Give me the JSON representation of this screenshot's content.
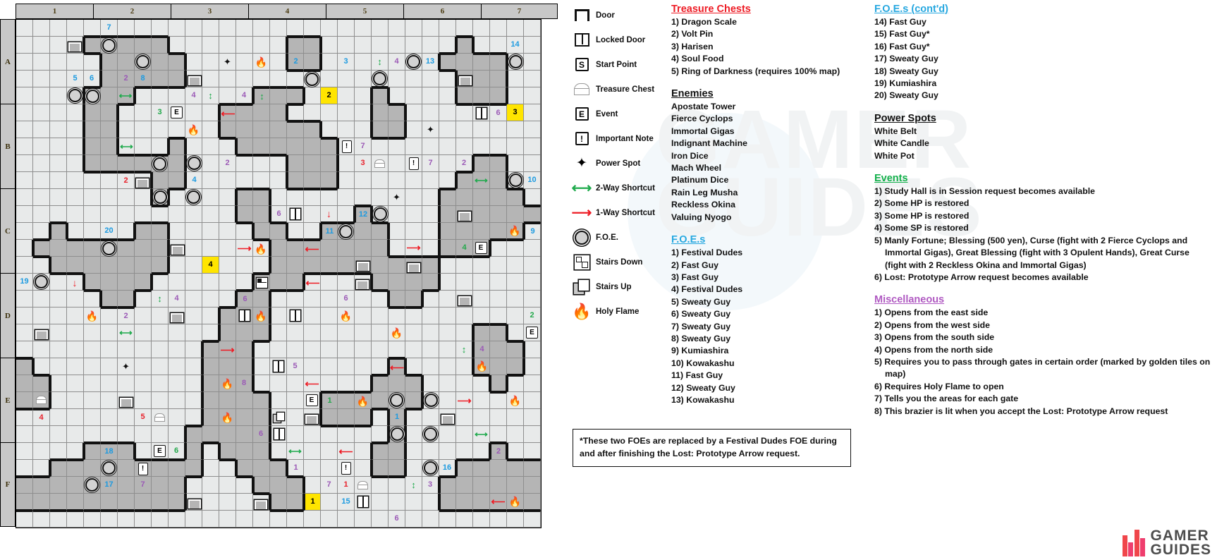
{
  "map": {
    "col_headers": [
      "1",
      "2",
      "3",
      "4",
      "5",
      "6",
      "7"
    ],
    "row_headers": [
      "A",
      "B",
      "C",
      "D",
      "E",
      "F"
    ],
    "cols": 31,
    "rows": 30,
    "markers": [
      {
        "c": 5,
        "r": 0,
        "type": "num",
        "text": "7",
        "color": "blue"
      },
      {
        "c": 5,
        "r": 1,
        "type": "foe"
      },
      {
        "c": 3,
        "r": 1,
        "type": "door"
      },
      {
        "c": 7,
        "r": 2,
        "type": "foe"
      },
      {
        "c": 12,
        "r": 2,
        "type": "spark"
      },
      {
        "c": 14,
        "r": 2,
        "type": "flame"
      },
      {
        "c": 16,
        "r": 2,
        "type": "num",
        "text": "2",
        "color": "blue"
      },
      {
        "c": 19,
        "r": 2,
        "type": "num",
        "text": "3",
        "color": "blue"
      },
      {
        "c": 21,
        "r": 2,
        "type": "shortcut2v"
      },
      {
        "c": 22,
        "r": 2,
        "type": "num",
        "text": "4",
        "color": "purple"
      },
      {
        "c": 23,
        "r": 2,
        "type": "foe"
      },
      {
        "c": 24,
        "r": 2,
        "type": "num",
        "text": "13",
        "color": "blue"
      },
      {
        "c": 29,
        "r": 1,
        "type": "num",
        "text": "14",
        "color": "blue"
      },
      {
        "c": 29,
        "r": 2,
        "type": "foe"
      },
      {
        "c": 3,
        "r": 3,
        "type": "num",
        "text": "5",
        "color": "blue"
      },
      {
        "c": 4,
        "r": 3,
        "type": "num",
        "text": "6",
        "color": "blue"
      },
      {
        "c": 6,
        "r": 3,
        "type": "num",
        "text": "2",
        "color": "purple"
      },
      {
        "c": 7,
        "r": 3,
        "type": "num",
        "text": "8",
        "color": "blue"
      },
      {
        "c": 10,
        "r": 3,
        "type": "door"
      },
      {
        "c": 17,
        "r": 3,
        "type": "foe"
      },
      {
        "c": 21,
        "r": 3,
        "type": "foe"
      },
      {
        "c": 26,
        "r": 3,
        "type": "door"
      },
      {
        "c": 3,
        "r": 4,
        "type": "foe"
      },
      {
        "c": 4,
        "r": 4,
        "type": "foe"
      },
      {
        "c": 6,
        "r": 4,
        "type": "shortcut2h"
      },
      {
        "c": 10,
        "r": 4,
        "type": "num",
        "text": "4",
        "color": "purple"
      },
      {
        "c": 11,
        "r": 4,
        "type": "shortcut2v"
      },
      {
        "c": 13,
        "r": 4,
        "type": "num",
        "text": "4",
        "color": "purple"
      },
      {
        "c": 14,
        "r": 4,
        "type": "shortcut2v"
      },
      {
        "c": 18,
        "r": 4,
        "type": "gold",
        "text": "2"
      },
      {
        "c": 8,
        "r": 5,
        "type": "num",
        "text": "3",
        "color": "green"
      },
      {
        "c": 9,
        "r": 5,
        "type": "event"
      },
      {
        "c": 12,
        "r": 5,
        "type": "shortcut1l"
      },
      {
        "c": 27,
        "r": 5,
        "type": "lockdoor"
      },
      {
        "c": 28,
        "r": 5,
        "type": "num",
        "text": "6",
        "color": "purple"
      },
      {
        "c": 29,
        "r": 5,
        "type": "gold",
        "text": "3"
      },
      {
        "c": 10,
        "r": 6,
        "type": "flame"
      },
      {
        "c": 24,
        "r": 6,
        "type": "spark"
      },
      {
        "c": 6,
        "r": 7,
        "type": "shortcut2h"
      },
      {
        "c": 19,
        "r": 7,
        "type": "note"
      },
      {
        "c": 20,
        "r": 7,
        "type": "num",
        "text": "7",
        "color": "purple"
      },
      {
        "c": 8,
        "r": 8,
        "type": "foe"
      },
      {
        "c": 10,
        "r": 8,
        "type": "foe"
      },
      {
        "c": 12,
        "r": 8,
        "type": "num",
        "text": "2",
        "color": "purple"
      },
      {
        "c": 20,
        "r": 8,
        "type": "num",
        "text": "3",
        "color": "red"
      },
      {
        "c": 21,
        "r": 8,
        "type": "chest"
      },
      {
        "c": 23,
        "r": 8,
        "type": "note"
      },
      {
        "c": 24,
        "r": 8,
        "type": "num",
        "text": "7",
        "color": "purple"
      },
      {
        "c": 26,
        "r": 8,
        "type": "num",
        "text": "2",
        "color": "purple"
      },
      {
        "c": 6,
        "r": 9,
        "type": "num",
        "text": "2",
        "color": "red"
      },
      {
        "c": 7,
        "r": 9,
        "type": "door"
      },
      {
        "c": 10,
        "r": 9,
        "type": "num",
        "text": "4",
        "color": "blue"
      },
      {
        "c": 27,
        "r": 9,
        "type": "shortcut2h"
      },
      {
        "c": 29,
        "r": 9,
        "type": "foe"
      },
      {
        "c": 30,
        "r": 9,
        "type": "num",
        "text": "10",
        "color": "blue"
      },
      {
        "c": 8,
        "r": 10,
        "type": "foe"
      },
      {
        "c": 10,
        "r": 10,
        "type": "foe"
      },
      {
        "c": 22,
        "r": 10,
        "type": "spark"
      },
      {
        "c": 15,
        "r": 11,
        "type": "num",
        "text": "6",
        "color": "purple"
      },
      {
        "c": 16,
        "r": 11,
        "type": "lockdoor"
      },
      {
        "c": 18,
        "r": 11,
        "type": "shortcut1d"
      },
      {
        "c": 20,
        "r": 11,
        "type": "num",
        "text": "12",
        "color": "blue"
      },
      {
        "c": 21,
        "r": 11,
        "type": "foe"
      },
      {
        "c": 26,
        "r": 11,
        "type": "door"
      },
      {
        "c": 5,
        "r": 12,
        "type": "num",
        "text": "20",
        "color": "blue"
      },
      {
        "c": 18,
        "r": 12,
        "type": "num",
        "text": "11",
        "color": "blue"
      },
      {
        "c": 19,
        "r": 12,
        "type": "foe"
      },
      {
        "c": 29,
        "r": 12,
        "type": "flame"
      },
      {
        "c": 30,
        "r": 12,
        "type": "num",
        "text": "9",
        "color": "blue"
      },
      {
        "c": 5,
        "r": 13,
        "type": "foe"
      },
      {
        "c": 9,
        "r": 13,
        "type": "door"
      },
      {
        "c": 13,
        "r": 13,
        "type": "shortcut1r"
      },
      {
        "c": 14,
        "r": 13,
        "type": "flame"
      },
      {
        "c": 17,
        "r": 13,
        "type": "shortcut1l"
      },
      {
        "c": 23,
        "r": 13,
        "type": "shortcut1r"
      },
      {
        "c": 26,
        "r": 13,
        "type": "num",
        "text": "4",
        "color": "green"
      },
      {
        "c": 27,
        "r": 13,
        "type": "event"
      },
      {
        "c": 11,
        "r": 14,
        "type": "gold",
        "text": "4"
      },
      {
        "c": 20,
        "r": 14,
        "type": "door"
      },
      {
        "c": 23,
        "r": 14,
        "type": "door"
      },
      {
        "c": 0,
        "r": 15,
        "type": "num",
        "text": "19",
        "color": "blue"
      },
      {
        "c": 1,
        "r": 15,
        "type": "foe"
      },
      {
        "c": 3,
        "r": 15,
        "type": "shortcut1d"
      },
      {
        "c": 14,
        "r": 15,
        "type": "stairsdown"
      },
      {
        "c": 17,
        "r": 15,
        "type": "shortcut1l"
      },
      {
        "c": 20,
        "r": 15,
        "type": "door"
      },
      {
        "c": 8,
        "r": 16,
        "type": "shortcut2v"
      },
      {
        "c": 9,
        "r": 16,
        "type": "num",
        "text": "4",
        "color": "purple"
      },
      {
        "c": 13,
        "r": 16,
        "type": "num",
        "text": "6",
        "color": "purple"
      },
      {
        "c": 19,
        "r": 16,
        "type": "num",
        "text": "6",
        "color": "purple"
      },
      {
        "c": 26,
        "r": 16,
        "type": "door"
      },
      {
        "c": 4,
        "r": 17,
        "type": "flame"
      },
      {
        "c": 6,
        "r": 17,
        "type": "num",
        "text": "2",
        "color": "purple"
      },
      {
        "c": 9,
        "r": 17,
        "type": "door"
      },
      {
        "c": 13,
        "r": 17,
        "type": "lockdoor"
      },
      {
        "c": 14,
        "r": 17,
        "type": "flame"
      },
      {
        "c": 16,
        "r": 17,
        "type": "lockdoor"
      },
      {
        "c": 19,
        "r": 17,
        "type": "flame"
      },
      {
        "c": 30,
        "r": 17,
        "type": "num",
        "text": "2",
        "color": "green"
      },
      {
        "c": 1,
        "r": 18,
        "type": "door"
      },
      {
        "c": 6,
        "r": 18,
        "type": "shortcut2h"
      },
      {
        "c": 22,
        "r": 18,
        "type": "flame"
      },
      {
        "c": 30,
        "r": 18,
        "type": "event"
      },
      {
        "c": 12,
        "r": 19,
        "type": "shortcut1r"
      },
      {
        "c": 26,
        "r": 19,
        "type": "shortcut2v"
      },
      {
        "c": 27,
        "r": 19,
        "type": "num",
        "text": "4",
        "color": "purple"
      },
      {
        "c": 6,
        "r": 20,
        "type": "spark"
      },
      {
        "c": 15,
        "r": 20,
        "type": "lockdoor"
      },
      {
        "c": 16,
        "r": 20,
        "type": "num",
        "text": "5",
        "color": "purple"
      },
      {
        "c": 22,
        "r": 20,
        "type": "shortcut1l"
      },
      {
        "c": 27,
        "r": 20,
        "type": "flame"
      },
      {
        "c": 12,
        "r": 21,
        "type": "flame"
      },
      {
        "c": 13,
        "r": 21,
        "type": "num",
        "text": "8",
        "color": "purple"
      },
      {
        "c": 17,
        "r": 21,
        "type": "shortcut1l"
      },
      {
        "c": 1,
        "r": 22,
        "type": "chest"
      },
      {
        "c": 6,
        "r": 22,
        "type": "door"
      },
      {
        "c": 17,
        "r": 22,
        "type": "event"
      },
      {
        "c": 18,
        "r": 22,
        "type": "num",
        "text": "1",
        "color": "green"
      },
      {
        "c": 20,
        "r": 22,
        "type": "flame"
      },
      {
        "c": 22,
        "r": 22,
        "type": "foe"
      },
      {
        "c": 24,
        "r": 22,
        "type": "foe"
      },
      {
        "c": 26,
        "r": 22,
        "type": "shortcut1r"
      },
      {
        "c": 29,
        "r": 22,
        "type": "flame"
      },
      {
        "c": 1,
        "r": 23,
        "type": "num",
        "text": "4",
        "color": "red"
      },
      {
        "c": 7,
        "r": 23,
        "type": "num",
        "text": "5",
        "color": "red"
      },
      {
        "c": 8,
        "r": 23,
        "type": "chest"
      },
      {
        "c": 12,
        "r": 23,
        "type": "flame"
      },
      {
        "c": 15,
        "r": 23,
        "type": "stairsup"
      },
      {
        "c": 17,
        "r": 23,
        "type": "door"
      },
      {
        "c": 22,
        "r": 23,
        "type": "num",
        "text": "1",
        "color": "blue"
      },
      {
        "c": 25,
        "r": 23,
        "type": "door"
      },
      {
        "c": 14,
        "r": 24,
        "type": "num",
        "text": "6",
        "color": "purple"
      },
      {
        "c": 15,
        "r": 24,
        "type": "lockdoor"
      },
      {
        "c": 22,
        "r": 24,
        "type": "foe"
      },
      {
        "c": 24,
        "r": 24,
        "type": "foe"
      },
      {
        "c": 27,
        "r": 24,
        "type": "shortcut2h"
      },
      {
        "c": 5,
        "r": 25,
        "type": "num",
        "text": "18",
        "color": "blue"
      },
      {
        "c": 8,
        "r": 25,
        "type": "event"
      },
      {
        "c": 9,
        "r": 25,
        "type": "num",
        "text": "6",
        "color": "green"
      },
      {
        "c": 16,
        "r": 25,
        "type": "shortcut2h"
      },
      {
        "c": 19,
        "r": 25,
        "type": "shortcut1l"
      },
      {
        "c": 28,
        "r": 25,
        "type": "num",
        "text": "2",
        "color": "purple"
      },
      {
        "c": 5,
        "r": 26,
        "type": "foe"
      },
      {
        "c": 7,
        "r": 26,
        "type": "note"
      },
      {
        "c": 16,
        "r": 26,
        "type": "num",
        "text": "1",
        "color": "purple"
      },
      {
        "c": 19,
        "r": 26,
        "type": "note"
      },
      {
        "c": 24,
        "r": 26,
        "type": "foe"
      },
      {
        "c": 25,
        "r": 26,
        "type": "num",
        "text": "16",
        "color": "blue"
      },
      {
        "c": 4,
        "r": 27,
        "type": "foe"
      },
      {
        "c": 5,
        "r": 27,
        "type": "num",
        "text": "17",
        "color": "blue"
      },
      {
        "c": 7,
        "r": 27,
        "type": "num",
        "text": "7",
        "color": "purple"
      },
      {
        "c": 18,
        "r": 27,
        "type": "num",
        "text": "7",
        "color": "purple"
      },
      {
        "c": 19,
        "r": 27,
        "type": "num",
        "text": "1",
        "color": "red"
      },
      {
        "c": 20,
        "r": 27,
        "type": "chest"
      },
      {
        "c": 23,
        "r": 27,
        "type": "shortcut2v"
      },
      {
        "c": 24,
        "r": 27,
        "type": "num",
        "text": "3",
        "color": "purple"
      },
      {
        "c": 10,
        "r": 28,
        "type": "door"
      },
      {
        "c": 14,
        "r": 28,
        "type": "door"
      },
      {
        "c": 17,
        "r": 28,
        "type": "gold",
        "text": "1"
      },
      {
        "c": 20,
        "r": 28,
        "type": "lockdoor"
      },
      {
        "c": 19,
        "r": 28,
        "type": "num",
        "text": "15",
        "color": "blue"
      },
      {
        "c": 28,
        "r": 28,
        "type": "shortcut1l"
      },
      {
        "c": 29,
        "r": 28,
        "type": "flame"
      },
      {
        "c": 22,
        "r": 29,
        "type": "num",
        "text": "6",
        "color": "purple"
      }
    ]
  },
  "legend": {
    "items": [
      {
        "icon": "door-icon",
        "label": "Door"
      },
      {
        "icon": "locked-door-icon",
        "label": "Locked Door"
      },
      {
        "icon": "start-point-icon",
        "label": "Start Point"
      },
      {
        "icon": "treasure-chest-icon",
        "label": "Treasure Chest"
      },
      {
        "icon": "event-icon",
        "label": "Event"
      },
      {
        "icon": "important-note-icon",
        "label": "Important Note"
      },
      {
        "icon": "power-spot-icon",
        "label": "Power Spot"
      },
      {
        "icon": "two-way-shortcut-icon",
        "label": "2-Way Shortcut"
      },
      {
        "icon": "one-way-shortcut-icon",
        "label": "1-Way Shortcut"
      },
      {
        "icon": "foe-icon",
        "label": "F.O.E."
      },
      {
        "icon": "stairs-down-icon",
        "label": "Stairs Down"
      },
      {
        "icon": "stairs-up-icon",
        "label": "Stairs Up"
      },
      {
        "icon": "holy-flame-icon",
        "label": "Holy Flame"
      }
    ],
    "start_point_letter": "S",
    "event_letter": "E",
    "note_mark": "!"
  },
  "sections": {
    "treasure_chests": {
      "title": "Treasure Chests",
      "items": [
        "1) Dragon Scale",
        "2) Volt Pin",
        "3) Harisen",
        "4) Soul Food",
        "5) Ring of Darkness (requires 100% map)"
      ]
    },
    "enemies": {
      "title": "Enemies",
      "items": [
        "Apostate Tower",
        "Fierce Cyclops",
        "Immortal Gigas",
        "Indignant Machine",
        "Iron Dice",
        "Mach Wheel",
        "Platinum Dice",
        "Rain Leg Musha",
        "Reckless Okina",
        "Valuing Nyogo"
      ]
    },
    "foes": {
      "title": "F.O.E.s",
      "items": [
        "1) Festival Dudes",
        "2) Fast Guy",
        "3) Fast Guy",
        "4) Festival Dudes",
        "5) Sweaty Guy",
        "6) Sweaty Guy",
        "7) Sweaty Guy",
        "8) Sweaty Guy",
        "9) Kumiashira",
        "10) Kowakashu",
        "11) Fast Guy",
        "12) Sweaty Guy",
        "13) Kowakashu"
      ]
    },
    "foes_cont": {
      "title": "F.O.E.s (cont'd)",
      "items": [
        "14) Fast Guy",
        "15) Fast Guy*",
        "16) Fast Guy*",
        "17) Sweaty Guy",
        "18) Sweaty Guy",
        "19) Kumiashira",
        "20) Sweaty Guy"
      ]
    },
    "power_spots": {
      "title": "Power Spots",
      "items": [
        "White Belt",
        "White Candle",
        "White Pot"
      ]
    },
    "events": {
      "title": "Events",
      "items": [
        "1) Study Hall is in Session request becomes available",
        "2) Some HP is restored",
        "3) Some HP is restored",
        "4) Some SP is restored",
        "5) Manly Fortune; Blessing (500 yen), Curse (fight with 2 Fierce Cyclops and Immortal Gigas), Great Blessing (fight with 3 Opulent Hands), Great Curse (fight with 2 Reckless Okina and Immortal Gigas)",
        "6) Lost: Prototype Arrow request becomes available"
      ]
    },
    "miscellaneous": {
      "title": "Miscellaneous",
      "items": [
        "1) Opens from the east side",
        "2) Opens from the west side",
        "3) Opens from the south side",
        "4) Opens from the north side",
        "5) Requires you to pass through gates in certain order (marked by golden tiles on map)",
        "6) Requires Holy Flame to open",
        "7) Tells you the areas for each gate",
        "8) This brazier is lit when you accept the Lost: Prototype Arrow request"
      ]
    }
  },
  "footnote": {
    "text": "*These two FOEs are replaced by a Festival Dudes FOE during and after finishing the Lost: Prototype Arrow request."
  },
  "brand": {
    "line1": "GAMER",
    "line2": "GUIDES"
  },
  "watermark": {
    "line1": "GAMER",
    "line2": "GUIDES"
  },
  "colors": {
    "treasure_heading": "#ee1c25",
    "foe_heading": "#27a8e0",
    "events_heading": "#13b04b",
    "misc_heading": "#b05ac2",
    "gold_tile": "#ffe500",
    "shortcut_two_way": "#1faa4c",
    "shortcut_one_way": "#ee1c25",
    "flame": "#f4621f",
    "wall_dark": "#b5b5b5",
    "floor_light": "#e8eaea"
  }
}
